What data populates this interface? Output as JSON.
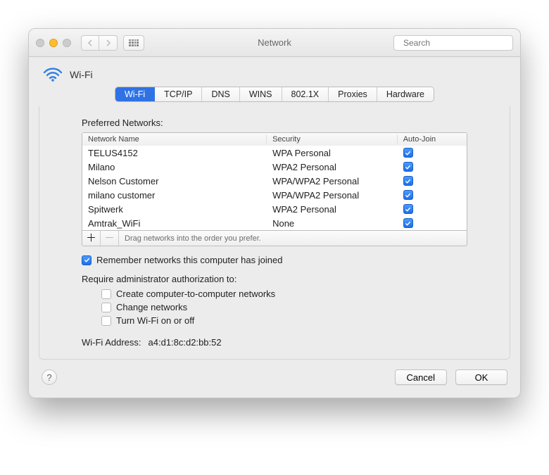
{
  "window": {
    "title": "Network"
  },
  "search": {
    "placeholder": "Search"
  },
  "header": {
    "title": "Wi-Fi"
  },
  "tabs": [
    "Wi-Fi",
    "TCP/IP",
    "DNS",
    "WINS",
    "802.1X",
    "Proxies",
    "Hardware"
  ],
  "active_tab": 0,
  "section": {
    "preferred_label": "Preferred Networks:",
    "columns": {
      "name": "Network Name",
      "security": "Security",
      "autojoin": "Auto-Join"
    },
    "networks": [
      {
        "name": "TELUS4152",
        "security": "WPA Personal",
        "autojoin": true
      },
      {
        "name": "Milano",
        "security": "WPA2 Personal",
        "autojoin": true
      },
      {
        "name": "Nelson Customer",
        "security": "WPA/WPA2 Personal",
        "autojoin": true
      },
      {
        "name": "milano customer",
        "security": "WPA/WPA2 Personal",
        "autojoin": true
      },
      {
        "name": "Spitwerk",
        "security": "WPA2 Personal",
        "autojoin": true
      },
      {
        "name": "Amtrak_WiFi",
        "security": "None",
        "autojoin": true
      }
    ],
    "drag_hint": "Drag networks into the order you prefer.",
    "remember_label": "Remember networks this computer has joined",
    "remember_checked": true,
    "require_label": "Require administrator authorization to:",
    "require_opts": [
      {
        "label": "Create computer-to-computer networks",
        "checked": false
      },
      {
        "label": "Change networks",
        "checked": false
      },
      {
        "label": "Turn Wi-Fi on or off",
        "checked": false
      }
    ],
    "address_label": "Wi-Fi Address:",
    "address_value": "a4:d1:8c:d2:bb:52"
  },
  "footer": {
    "help": "?",
    "cancel": "Cancel",
    "ok": "OK"
  }
}
